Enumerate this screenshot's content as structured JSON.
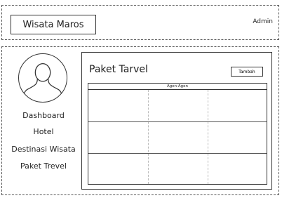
{
  "header": {
    "brand": "Wisata Maros",
    "user": "Admin"
  },
  "sidebar": {
    "items": [
      {
        "label": "Dashboard"
      },
      {
        "label": "Hotel"
      },
      {
        "label": "Destinasi Wisata"
      },
      {
        "label": "Paket Trevel"
      }
    ]
  },
  "main": {
    "title": "Paket Tarvel",
    "add_button": "Tambah",
    "table_header": "Agen-Agen"
  }
}
